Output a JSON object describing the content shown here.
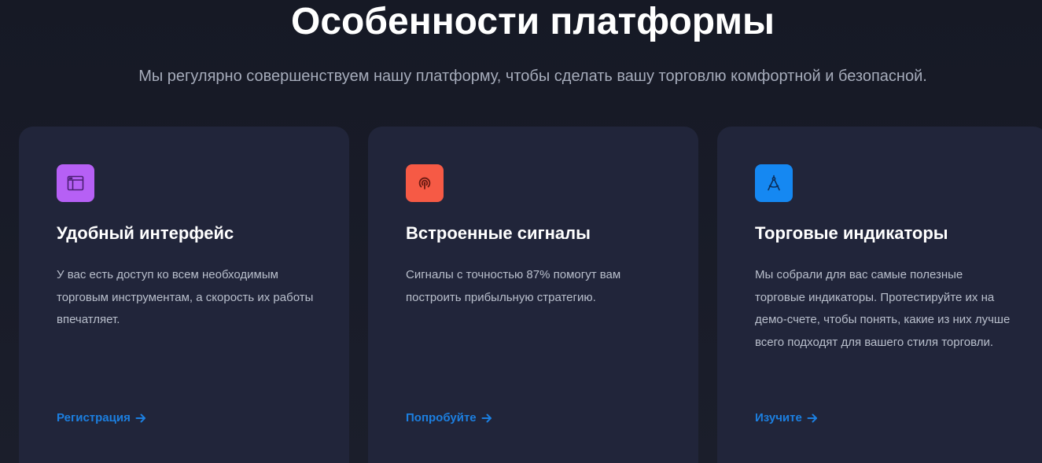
{
  "header": {
    "title": "Особенности платформы",
    "subtitle": "Мы регулярно совершенствуем нашу платформу, чтобы сделать вашу торговлю комфортной и безопасной."
  },
  "cards": [
    {
      "icon": "browser-window-icon",
      "icon_color": "#b660f5",
      "title": "Удобный интерфейс",
      "text": "У вас есть доступ ко всем необходимым торговым инструментам, а скорость их работы впечатляет.",
      "link": "Регистрация"
    },
    {
      "icon": "signal-broadcast-icon",
      "icon_color": "#f65a45",
      "title": "Встроенные сигналы",
      "text": "Сигналы с точностью 87% помогут вам построить прибыльную стратегию.",
      "link": "Попробуйте"
    },
    {
      "icon": "compass-drawing-icon",
      "icon_color": "#1588f2",
      "title": "Торговые индикаторы",
      "text": "Мы собрали для вас самые полезные торговые индикаторы. Протестируйте их на демо-счете, чтобы понять, какие из них лучше всего подходят для вашего стиля торговли.",
      "link": "Изучите"
    }
  ],
  "colors": {
    "background": "#181b28",
    "card_background": "#21253a",
    "link": "#1c7fe0"
  }
}
